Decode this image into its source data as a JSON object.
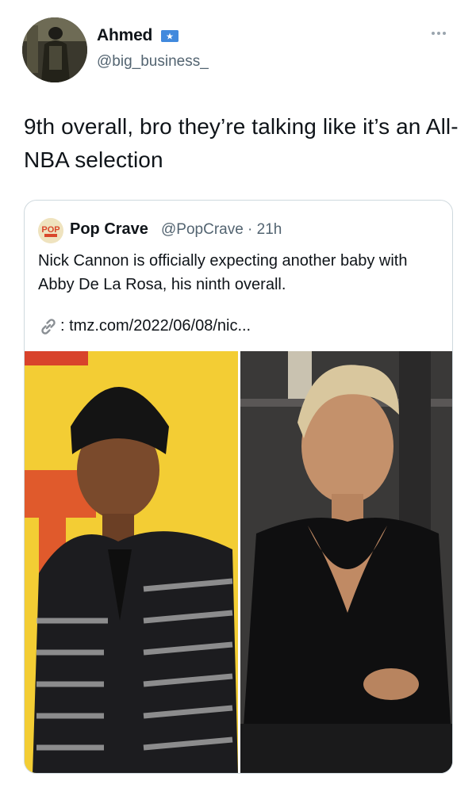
{
  "tweet": {
    "author": {
      "name": "Ahmed",
      "handle": "@big_business_",
      "flag_icon": "somalia-flag-icon",
      "avatar_icon": "user-avatar"
    },
    "text": "9th overall, bro they’re talking like it’s an All-NBA selection",
    "more_icon": "more-horizontal-icon"
  },
  "quote": {
    "author_name": "Pop Crave",
    "handle_time": "@PopCrave · 21h",
    "text": "Nick Cannon is officially expecting another baby with Abby De La Rosa, his ninth overall.",
    "link_icon": "link-icon",
    "link_text": ": tmz.com/2022/06/08/nic...",
    "logo_text": "POP"
  },
  "colors": {
    "text": "#0f1419",
    "secondary": "#536471",
    "border": "#cfd9de",
    "flag_blue": "#4189dd"
  }
}
